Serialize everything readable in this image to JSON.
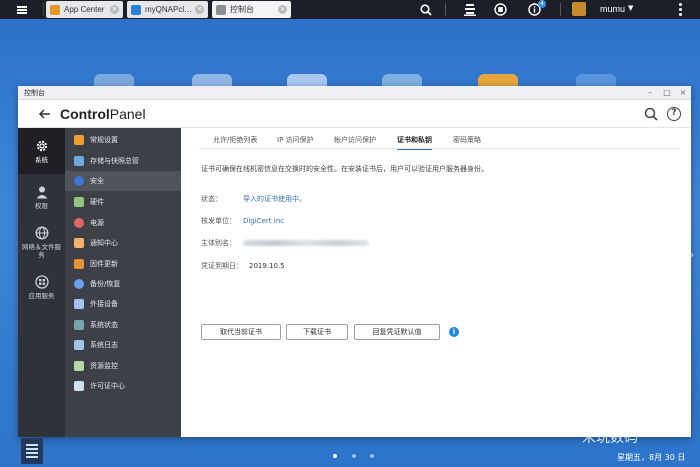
{
  "taskbar": {
    "tabs": [
      {
        "label": "App Center",
        "active": false,
        "icon_color": "#e39a2b"
      },
      {
        "label": "myQNAPcl…",
        "active": false,
        "icon_color": "#2a7fd6"
      },
      {
        "label": "控制台",
        "active": true,
        "icon_color": "#8a8f98"
      }
    ],
    "notification_count": "4",
    "user": "mumu"
  },
  "window": {
    "title": "控制台",
    "app_title_bold": "Control",
    "app_title_light": "Panel"
  },
  "categories": [
    {
      "label": "系统",
      "icon": "gear-icon",
      "active": true
    },
    {
      "label": "权限",
      "icon": "user-icon",
      "active": false
    },
    {
      "label": "网络＆文件服务",
      "icon": "globe-icon",
      "active": false
    },
    {
      "label": "应用服务",
      "icon": "apps-icon",
      "active": false
    }
  ],
  "subnav": [
    {
      "label": "常规设置",
      "color": "#f0a030",
      "active": false
    },
    {
      "label": "存储与快照总管",
      "color": "#6fa8dc",
      "active": false
    },
    {
      "label": "安全",
      "color": "#3c78d8",
      "active": true
    },
    {
      "label": "硬件",
      "color": "#93c47d",
      "active": false
    },
    {
      "label": "电源",
      "color": "#e06666",
      "active": false
    },
    {
      "label": "通知中心",
      "color": "#f6b26b",
      "active": false
    },
    {
      "label": "固件更新",
      "color": "#e69138",
      "active": false
    },
    {
      "label": "备份/恢复",
      "color": "#6d9eeb",
      "active": false
    },
    {
      "label": "外接设备",
      "color": "#a4c2f4",
      "active": false
    },
    {
      "label": "系统状态",
      "color": "#76a5af",
      "active": false
    },
    {
      "label": "系统日志",
      "color": "#9fc5e8",
      "active": false
    },
    {
      "label": "资源监控",
      "color": "#b6d7a8",
      "active": false
    },
    {
      "label": "许可证中心",
      "color": "#cfe2f3",
      "active": false
    }
  ],
  "content": {
    "tabs": [
      {
        "label": "允许/拒绝列表",
        "active": false
      },
      {
        "label": "IP 访问保护",
        "active": false
      },
      {
        "label": "帐户访问保护",
        "active": false
      },
      {
        "label": "证书和私钥",
        "active": true
      },
      {
        "label": "密码策略",
        "active": false
      }
    ],
    "description": "证书可确保在线机密信息在交换时的安全性。在安装证书后，用户可以验证用户服务器身份。",
    "status_label": "状态：",
    "status_value": "导入的证书使用中。",
    "issuer_label": "核发单位：",
    "issuer_value": "DigiCert Inc",
    "subject_label": "主体别名：",
    "expiry_label": "凭证到期日：",
    "expiry_value": "2019.10.5",
    "buttons": {
      "replace": "取代当前证书",
      "download": "下载证书",
      "restore": "回复凭证默认值"
    }
  },
  "footer": {
    "watermark": "米玩数码",
    "clock": "星期五，8月 30 日"
  },
  "colors": {
    "accent": "#2b6fc8",
    "link": "#3b6fb8",
    "info": "#1e88e5"
  }
}
